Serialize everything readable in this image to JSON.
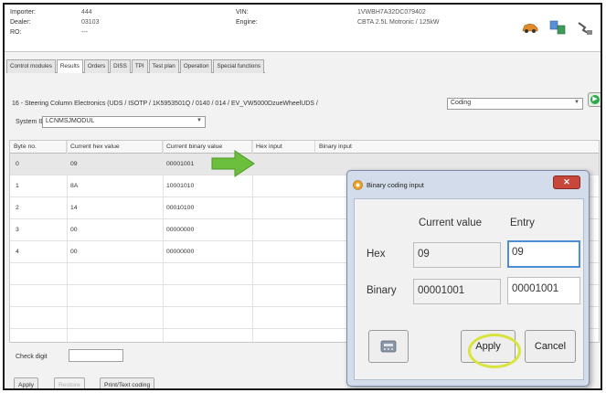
{
  "header": {
    "importer_label": "Importer:",
    "importer_value": "444",
    "dealer_label": "Dealer:",
    "dealer_value": "03103",
    "ro_label": "RO:",
    "ro_value": "---",
    "vin_label": "VIN:",
    "engine_label": "Engine:",
    "vin_value": "1VWBH7A32DC079402",
    "engine_value": "CBTA 2.5L Motronic / 125kW",
    "icons": [
      "car-icon",
      "transfer-icon",
      "plug-icon"
    ]
  },
  "tabs": [
    "Control modules",
    "Results",
    "Orders",
    "DISS",
    "TPI",
    "Test plan",
    "Operation",
    "Special functions"
  ],
  "module": {
    "path": "16 - Steering Column Electronics (UDS / ISOTP / 1K5953501Q / 0140 / 014 / EV_VW5000DzueWheelUDS /",
    "function_value": "Coding"
  },
  "system": {
    "label": "System ID",
    "value": "LCNMSJMODUL"
  },
  "grid": {
    "columns": [
      "Byte no.",
      "Current hex value",
      "Current binary value",
      "Hex input",
      "Binary input"
    ],
    "rows": [
      {
        "byte": "0",
        "hex": "09",
        "bin": "00001001"
      },
      {
        "byte": "1",
        "hex": "8A",
        "bin": "10001010"
      },
      {
        "byte": "2",
        "hex": "14",
        "bin": "00010100"
      },
      {
        "byte": "3",
        "hex": "00",
        "bin": "00000000"
      },
      {
        "byte": "4",
        "hex": "00",
        "bin": "00000000"
      }
    ]
  },
  "bottom": {
    "check_digit_label": "Check digit",
    "buttons": [
      "Apply",
      "Restore",
      "Print/Text coding"
    ]
  },
  "dialog": {
    "title": "Binary coding input",
    "col_current": "Current value",
    "col_entry": "Entry",
    "hex_label": "Hex",
    "hex_current": "09",
    "hex_entry": "09",
    "binary_label": "Binary",
    "binary_current": "00001001",
    "binary_entry": "00001001",
    "apply": "Apply",
    "cancel": "Cancel",
    "close_icon": "close-icon",
    "calc_icon": "calculator-icon"
  },
  "colors": {
    "accent_arrow": "#6bbf3c",
    "highlight_ring": "#d8e43a",
    "go_button": "#2ea84a",
    "close_button": "#c9463b"
  }
}
